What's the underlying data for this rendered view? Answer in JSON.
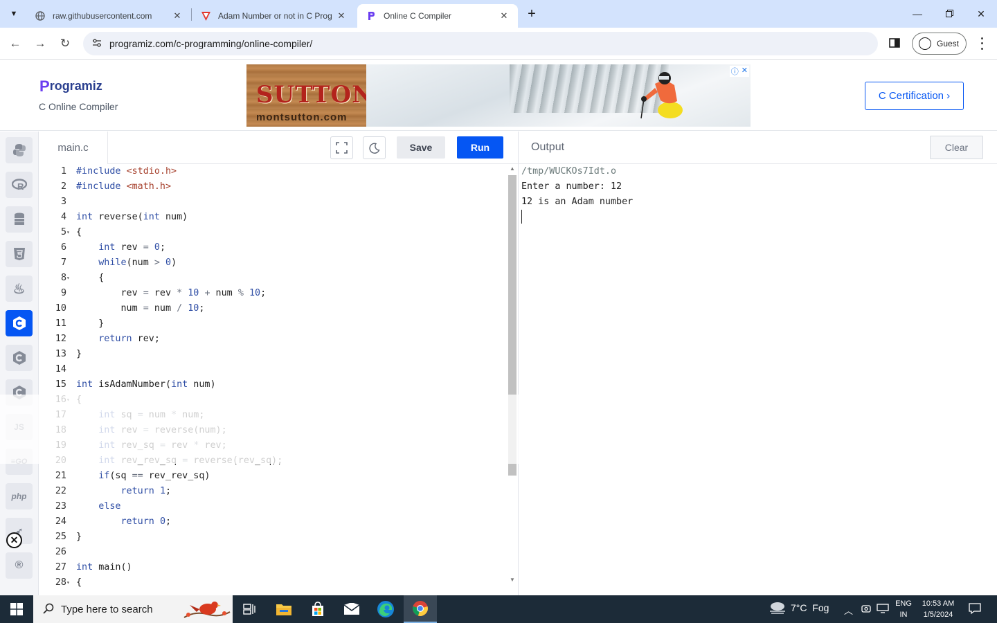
{
  "browser": {
    "tabs": [
      {
        "title": "raw.githubusercontent.com",
        "active": false
      },
      {
        "title": "Adam Number or not in C Prog",
        "active": false
      },
      {
        "title": "Online C Compiler",
        "active": true
      }
    ],
    "url": "programiz.com/c-programming/online-compiler/",
    "profile_label": "Guest"
  },
  "site": {
    "logo_text": "rogramiz",
    "logo_letter": "P",
    "subtitle": "C Online Compiler",
    "ad": {
      "brand": "SUTTON",
      "domain": "montsutton.com"
    },
    "cert_button": "C Certification ›"
  },
  "sidebar": {
    "languages": [
      {
        "name": "python",
        "glyph": "Py"
      },
      {
        "name": "r",
        "glyph": "R"
      },
      {
        "name": "sql",
        "glyph": "≡"
      },
      {
        "name": "html",
        "glyph": "5"
      },
      {
        "name": "java",
        "glyph": "♨"
      },
      {
        "name": "c",
        "glyph": "C",
        "active": true
      },
      {
        "name": "cpp",
        "glyph": "C"
      },
      {
        "name": "csharp",
        "glyph": "C"
      },
      {
        "name": "javascript",
        "glyph": "JS"
      },
      {
        "name": "go",
        "glyph": "GO"
      },
      {
        "name": "php",
        "glyph": "php"
      },
      {
        "name": "swift",
        "glyph": "S"
      },
      {
        "name": "rust",
        "glyph": "R"
      }
    ]
  },
  "editor": {
    "file_name": "main.c",
    "save_label": "Save",
    "run_label": "Run",
    "lines": [
      {
        "n": "1",
        "fold": false,
        "html": "<span class='kw'>#include</span> <span class='str'>&lt;stdio.h&gt;</span>"
      },
      {
        "n": "2",
        "fold": false,
        "html": "<span class='kw'>#include</span> <span class='str'>&lt;math.h&gt;</span>"
      },
      {
        "n": "3",
        "fold": false,
        "html": ""
      },
      {
        "n": "4",
        "fold": false,
        "html": "<span class='kw'>int</span> reverse(<span class='kw'>int</span> num)"
      },
      {
        "n": "5",
        "fold": true,
        "html": "{"
      },
      {
        "n": "6",
        "fold": false,
        "html": "    <span class='kw'>int</span> rev <span class='op'>=</span> <span class='num'>0</span>;"
      },
      {
        "n": "7",
        "fold": false,
        "html": "    <span class='kw'>while</span>(num <span class='op'>&gt;</span> <span class='num'>0</span>)"
      },
      {
        "n": "8",
        "fold": true,
        "html": "    {"
      },
      {
        "n": "9",
        "fold": false,
        "html": "        rev <span class='op'>=</span> rev <span class='op'>*</span> <span class='num'>10</span> <span class='op'>+</span> num <span class='op'>%</span> <span class='num'>10</span>;"
      },
      {
        "n": "10",
        "fold": false,
        "html": "        num <span class='op'>=</span> num <span class='op'>/</span> <span class='num'>10</span>;"
      },
      {
        "n": "11",
        "fold": false,
        "html": "    }"
      },
      {
        "n": "12",
        "fold": false,
        "html": "    <span class='kw'>return</span> rev;"
      },
      {
        "n": "13",
        "fold": false,
        "html": "}"
      },
      {
        "n": "14",
        "fold": false,
        "html": ""
      },
      {
        "n": "15",
        "fold": false,
        "html": "<span class='kw'>int</span> isAdamNumber(<span class='kw'>int</span> num)"
      },
      {
        "n": "16",
        "fold": true,
        "html": "{"
      },
      {
        "n": "17",
        "fold": false,
        "html": "    <span class='kw'>int</span> sq <span class='op'>=</span> num <span class='op'>*</span> num;"
      },
      {
        "n": "18",
        "fold": false,
        "html": "    <span class='kw'>int</span> rev <span class='op'>=</span> reverse(num);"
      },
      {
        "n": "19",
        "fold": false,
        "html": "    <span class='kw'>int</span> rev_sq <span class='op'>=</span> rev <span class='op'>*</span> rev;"
      },
      {
        "n": "20",
        "fold": false,
        "html": "    <span class='kw'>int</span> rev_rev_sq <span class='op'>=</span> reverse(rev_sq);"
      },
      {
        "n": "21",
        "fold": false,
        "html": "    <span class='kw'>if</span>(sq <span class='op'>==</span> rev_rev_sq)"
      },
      {
        "n": "22",
        "fold": false,
        "html": "        <span class='kw'>return</span> <span class='num'>1</span>;"
      },
      {
        "n": "23",
        "fold": false,
        "html": "    <span class='kw'>else</span>"
      },
      {
        "n": "24",
        "fold": false,
        "html": "        <span class='kw'>return</span> <span class='num'>0</span>;"
      },
      {
        "n": "25",
        "fold": false,
        "html": "}"
      },
      {
        "n": "26",
        "fold": false,
        "html": ""
      },
      {
        "n": "27",
        "fold": false,
        "html": "<span class='kw'>int</span> main()"
      },
      {
        "n": "28",
        "fold": true,
        "html": "{"
      }
    ]
  },
  "output": {
    "title": "Output",
    "clear_label": "Clear",
    "lines": [
      "/tmp/WUCKOs7Idt.o",
      "Enter a number: 12",
      "12 is an Adam number"
    ]
  },
  "taskbar": {
    "search_placeholder": "Type here to search",
    "weather": "7°C  Fog",
    "lang_top": "ENG",
    "lang_bottom": "IN",
    "time": "10:53 AM",
    "date": "1/5/2024"
  }
}
